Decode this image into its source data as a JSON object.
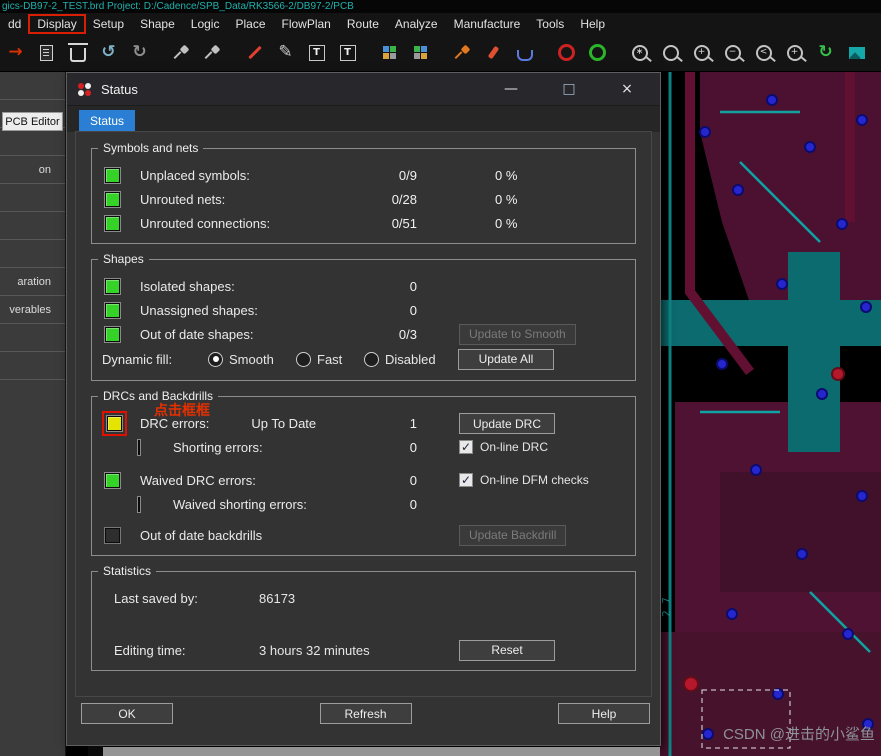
{
  "titlebar": {
    "text": "gics-DB97-2_TEST.brd Project: D:/Cadence/SPB_Data/RK3566-2/DB97-2/PCB"
  },
  "menu": {
    "items": [
      "dd",
      "Display",
      "Setup",
      "Shape",
      "Logic",
      "Place",
      "FlowPlan",
      "Route",
      "Analyze",
      "Manufacture",
      "Tools",
      "Help"
    ],
    "highlighted": "Display"
  },
  "toolbar": {
    "icons": [
      "add-arrow",
      "paste",
      "delete",
      "undo",
      "redo",
      "pin",
      "pin-angle",
      "line-slash",
      "pencil",
      "text",
      "text-edit",
      "module-swap",
      "module-update",
      "dart-orange",
      "brush",
      "via",
      "ratsnest-on",
      "ratsnest-off",
      "zoom-points",
      "zoom-fit",
      "zoom-in",
      "zoom-out",
      "zoom-previous",
      "zoom-selection",
      "redraw",
      "layers",
      "grid"
    ]
  },
  "glyphs": {
    "arrow": "→",
    "undo": "↺",
    "redo": "↻",
    "pencil": "✎",
    "text": "T",
    "check": "✓",
    "min": "—",
    "max": "□",
    "close": "×",
    "grid": "#",
    "refresh": "↻",
    "zoom_marks": [
      "∗",
      "",
      "+",
      "−",
      "<",
      "+"
    ]
  },
  "left_panel": {
    "tab": "PCB Editor",
    "rows": [
      "",
      "",
      "",
      "on",
      "",
      "",
      "",
      "aration",
      "verables",
      "",
      ""
    ]
  },
  "dialog": {
    "title": "Status",
    "tab": "Status",
    "symbols": {
      "title": "Symbols and nets",
      "rows": [
        {
          "label": "Unplaced symbols:",
          "value": "0/9",
          "pct": "0 %"
        },
        {
          "label": "Unrouted nets:",
          "value": "0/28",
          "pct": "0 %"
        },
        {
          "label": "Unrouted connections:",
          "value": "0/51",
          "pct": "0 %"
        }
      ]
    },
    "shapes": {
      "title": "Shapes",
      "rows": [
        {
          "label": "Isolated shapes:",
          "value": "0"
        },
        {
          "label": "Unassigned shapes:",
          "value": "0"
        },
        {
          "label": "Out of date shapes:",
          "value": "0/3"
        }
      ],
      "update_smooth_btn": "Update to Smooth",
      "dynamic_fill_label": "Dynamic fill:",
      "radio_smooth": "Smooth",
      "radio_fast": "Fast",
      "radio_disabled": "Disabled",
      "update_all_btn": "Update All"
    },
    "drc": {
      "title": "DRCs and Backdrills",
      "annotation": "点击框框",
      "row_drc_label": "DRC errors:",
      "row_drc_status": "Up To Date",
      "row_drc_value": "1",
      "update_drc_btn": "Update DRC",
      "row_shorting_label": "Shorting errors:",
      "row_shorting_value": "0",
      "online_drc_label": "On-line DRC",
      "row_waived_label": "Waived DRC errors:",
      "row_waived_value": "0",
      "online_dfm_label": "On-line DFM checks",
      "row_waived_short_label": "Waived shorting errors:",
      "row_waived_short_value": "0",
      "row_backdrill_label": "Out of date backdrills",
      "update_backdrill_btn": "Update Backdrill"
    },
    "stats": {
      "title": "Statistics",
      "saved_label": "Last saved by:",
      "saved_value": "86173",
      "editing_label": "Editing time:",
      "editing_value": "3 hours 32 minutes",
      "reset_btn": "Reset"
    },
    "ok_btn": "OK",
    "refresh_btn": "Refresh",
    "help_btn": "Help"
  },
  "pcb": {
    "side_text": "2 7"
  },
  "watermark": "CSDN @进击的小鲨鱼",
  "colors": {
    "accent_blue": "#2a7fd4",
    "led_green": "#35d227",
    "led_yellow": "#e4e400",
    "annotation_red": "#e01000",
    "title_teal": "#21b1ad",
    "pcb_maroon": "#4c1130",
    "pcb_teal": "#0c6b6e",
    "via_blue": "#2626cf"
  }
}
